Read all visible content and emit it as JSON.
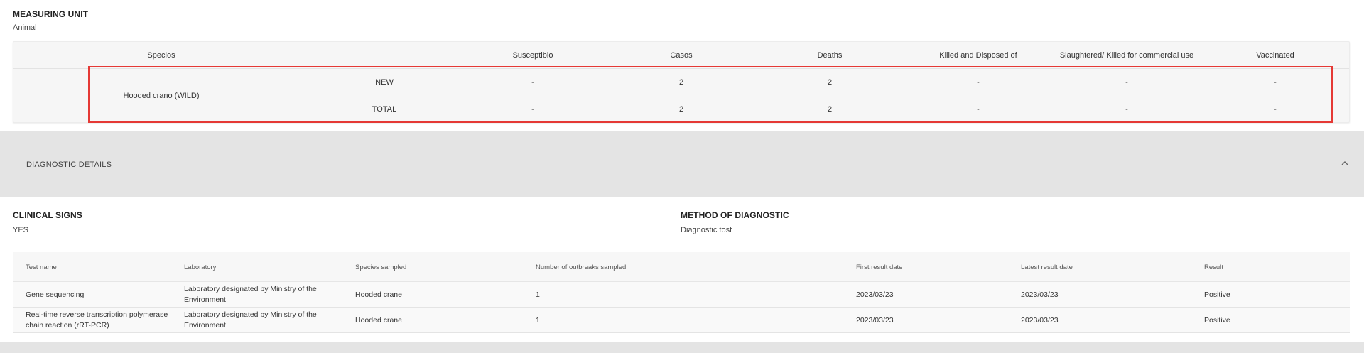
{
  "measuring_unit": {
    "title": "MEASURING UNIT",
    "value": "Animal"
  },
  "species_table": {
    "headers": [
      "Specios",
      "Susceptiblo",
      "Casos",
      "Deaths",
      "Killed and Disposed of",
      "Slaughtered/ Killed for commercial use",
      "Vaccinated"
    ],
    "species_name": "Hooded crano (WILD)",
    "rows": [
      {
        "label": "NEW",
        "susceptible": "-",
        "cases": "2",
        "deaths": "2",
        "killed": "-",
        "slaughtered": "-",
        "vaccinated": "-"
      },
      {
        "label": "TOTAL",
        "susceptible": "-",
        "cases": "2",
        "deaths": "2",
        "killed": "-",
        "slaughtered": "-",
        "vaccinated": "-"
      }
    ]
  },
  "diagnostic": {
    "title": "DIAGNOSTIC DETAILS",
    "icon": "chevron-up-icon"
  },
  "clinical_signs": {
    "title": "CLINICAL SIGNS",
    "value": "YES"
  },
  "method": {
    "title": "METHOD OF DIAGNOSTIC",
    "value": "Diagnostic tost"
  },
  "test_table": {
    "headers": [
      "Test name",
      "Laboratory",
      "Species sampled",
      "Number of outbreaks sampled",
      "First result date",
      "Latest result date",
      "Result"
    ],
    "rows": [
      {
        "test_name": [
          "Gene sequencing",
          ""
        ],
        "laboratory": [
          "Laboratory designated by Ministry of the",
          "Environment"
        ],
        "species": "Hooded crane",
        "outbreaks": "1",
        "first": "2023/03/23",
        "latest": "2023/03/23",
        "result": "Positive"
      },
      {
        "test_name": [
          "Real-time reverse transcription polymerase",
          "chain reaction (rRT-PCR)"
        ],
        "laboratory": [
          "Laboratory designated by Ministry of the",
          "Environment"
        ],
        "species": "Hooded crane",
        "outbreaks": "1",
        "first": "2023/03/23",
        "latest": "2023/03/23",
        "result": "Positive"
      }
    ]
  },
  "colors": {
    "highlight": "#e53935",
    "band": "#e4e4e4"
  }
}
